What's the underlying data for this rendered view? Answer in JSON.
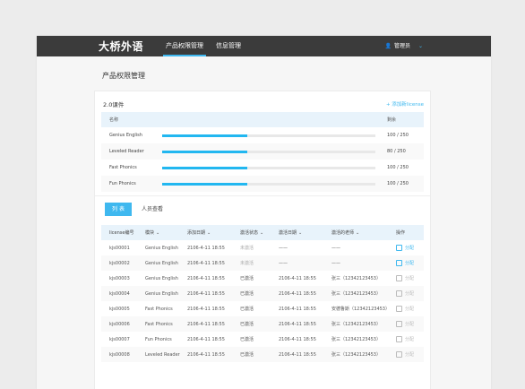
{
  "app": {
    "logo": "大桥外语",
    "nav": [
      {
        "label": "产品权限管理"
      },
      {
        "label": "信息管理"
      }
    ],
    "user": "管理员"
  },
  "page_title": "产品权限管理",
  "product_section": {
    "title": "2.0课件",
    "add_label": "+ 添加新license",
    "headers": {
      "name": "名称",
      "remain": "剩余"
    },
    "rows": [
      {
        "name": "Genius English",
        "remain": "100 / 250",
        "progress": 0.4
      },
      {
        "name": "Leveled Reader",
        "remain": "80 / 250",
        "progress": 0.4
      },
      {
        "name": "Fast Phonics",
        "remain": "100 / 250",
        "progress": 0.4
      },
      {
        "name": "Fun Phonics",
        "remain": "100 / 250",
        "progress": 0.4
      }
    ]
  },
  "tabs": {
    "list": "列 表",
    "people": "人员查看"
  },
  "license_table": {
    "headers": [
      "license编号",
      "模块",
      "添加日期",
      "激活状态",
      "激活日期",
      "激活的老师",
      "操作"
    ],
    "rows": [
      {
        "id": "kjs00001",
        "module": "Genius English",
        "date": "2106-4-11 18:55",
        "status": "未激活",
        "act_date": "——",
        "teacher": "——",
        "action": "分配"
      },
      {
        "id": "kjs00002",
        "module": "Genius English",
        "date": "2106-4-11 18:55",
        "status": "未激活",
        "act_date": "——",
        "teacher": "——",
        "action": "分配"
      },
      {
        "id": "kjs00003",
        "module": "Genius English",
        "date": "2106-4-11 18:55",
        "status": "已激活",
        "act_date": "2106-4-11 18:55",
        "teacher": "张三（12342123453）",
        "action": "分配"
      },
      {
        "id": "kjs00004",
        "module": "Genius English",
        "date": "2106-4-11 18:55",
        "status": "已激活",
        "act_date": "2106-4-11 18:55",
        "teacher": "张三（12342123453）",
        "action": "分配"
      },
      {
        "id": "kjs00005",
        "module": "Fast Phonics",
        "date": "2106-4-11 18:55",
        "status": "已激活",
        "act_date": "2106-4-11 18:55",
        "teacher": "安德鲁斯（12342123453）",
        "action": "分配"
      },
      {
        "id": "kjs00006",
        "module": "Fast Phonics",
        "date": "2106-4-11 18:55",
        "status": "已激活",
        "act_date": "2106-4-11 18:55",
        "teacher": "张三（12342123453）",
        "action": "分配"
      },
      {
        "id": "kjs00007",
        "module": "Fun Phonics",
        "date": "2106-4-11 18:55",
        "status": "已激活",
        "act_date": "2106-4-11 18:55",
        "teacher": "张三（12342123453）",
        "action": "分配"
      },
      {
        "id": "kjs00008",
        "module": "Leveled Reader",
        "date": "2106-4-11 18:55",
        "status": "已激活",
        "act_date": "2106-4-11 18:55",
        "teacher": "张三（12342123453）",
        "action": "分配"
      }
    ]
  }
}
